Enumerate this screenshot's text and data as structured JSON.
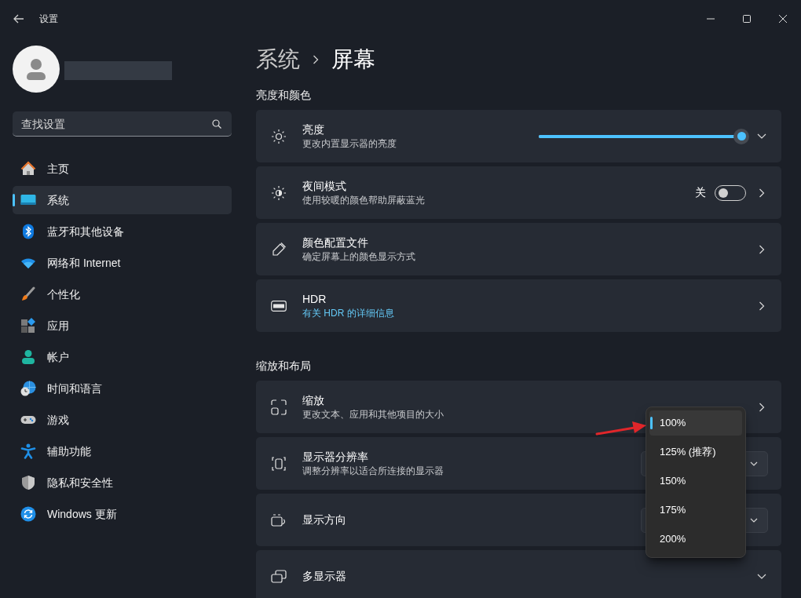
{
  "window": {
    "title": "设置"
  },
  "search": {
    "placeholder": "查找设置"
  },
  "sidebar": {
    "items": [
      {
        "label": "主页",
        "selected": false
      },
      {
        "label": "系统",
        "selected": true
      },
      {
        "label": "蓝牙和其他设备",
        "selected": false
      },
      {
        "label": "网络和 Internet",
        "selected": false
      },
      {
        "label": "个性化",
        "selected": false
      },
      {
        "label": "应用",
        "selected": false
      },
      {
        "label": "帐户",
        "selected": false
      },
      {
        "label": "时间和语言",
        "selected": false
      },
      {
        "label": "游戏",
        "selected": false
      },
      {
        "label": "辅助功能",
        "selected": false
      },
      {
        "label": "隐私和安全性",
        "selected": false
      },
      {
        "label": "Windows 更新",
        "selected": false
      }
    ]
  },
  "breadcrumb": [
    "系统",
    "屏幕"
  ],
  "sections": [
    {
      "title": "亮度和颜色",
      "cards": [
        {
          "kind": "slider",
          "title": "亮度",
          "subtitle": "更改内置显示器的亮度",
          "subtitle_link": false,
          "level": 1.0
        },
        {
          "kind": "toggle",
          "title": "夜间模式",
          "subtitle": "使用较暖的颜色帮助屏蔽蓝光",
          "subtitle_link": false,
          "state_label": "关",
          "on": false
        },
        {
          "kind": "link",
          "title": "颜色配置文件",
          "subtitle": "确定屏幕上的颜色显示方式",
          "subtitle_link": false
        },
        {
          "kind": "link",
          "title": "HDR",
          "subtitle": "有关 HDR 的详细信息",
          "subtitle_link": true
        }
      ]
    },
    {
      "title": "缩放和布局",
      "cards": [
        {
          "kind": "link",
          "title": "缩放",
          "subtitle": "更改文本、应用和其他项目的大小",
          "subtitle_link": false
        },
        {
          "kind": "combo",
          "title": "显示器分辨率",
          "subtitle": "调整分辨率以适合所连接的显示器",
          "subtitle_link": false
        },
        {
          "kind": "combo",
          "title": "显示方向"
        },
        {
          "kind": "expander",
          "title": "多显示器"
        }
      ]
    }
  ],
  "scale_menu": {
    "items": [
      {
        "label": "100%",
        "selected": true
      },
      {
        "label": "125% (推荐)",
        "selected": false
      },
      {
        "label": "150%",
        "selected": false
      },
      {
        "label": "175%",
        "selected": false
      },
      {
        "label": "200%",
        "selected": false
      }
    ]
  }
}
